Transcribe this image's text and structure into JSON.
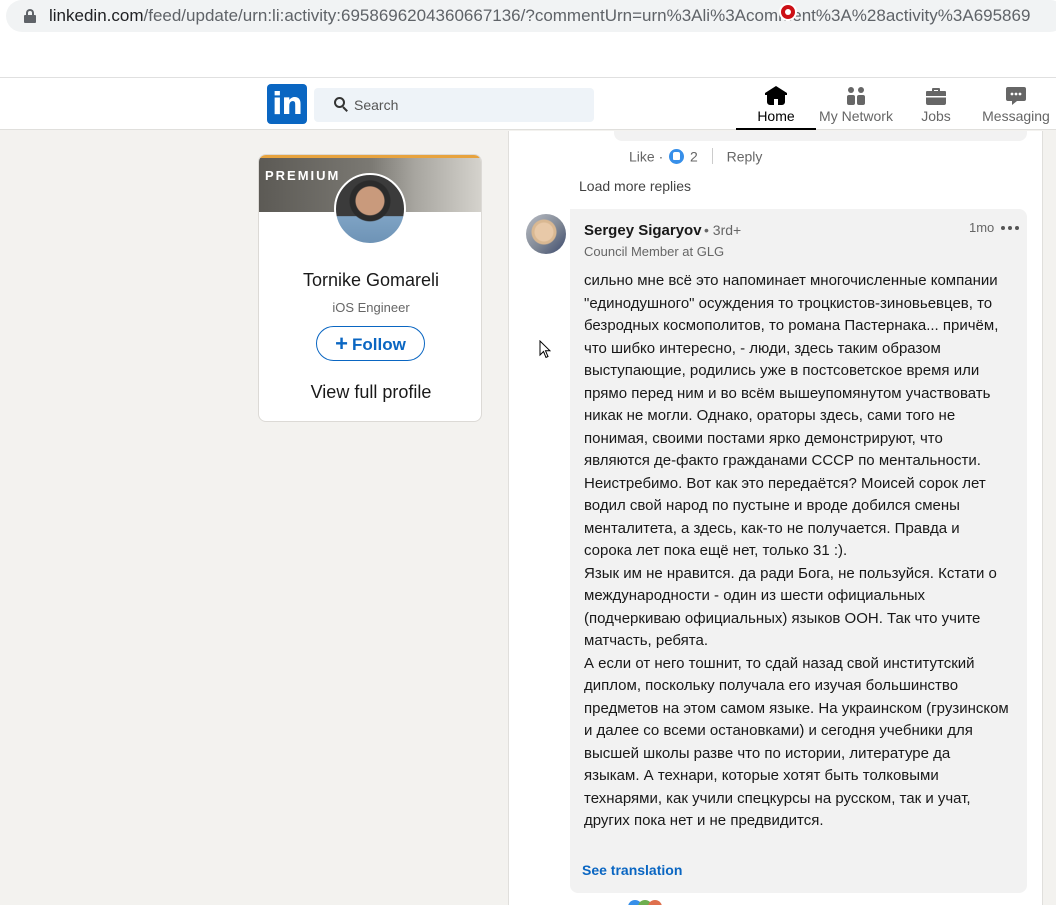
{
  "browser": {
    "url_host": "linkedin.com",
    "url_path": "/feed/update/urn:li:activity:6958696204360667136/?commentUrn=urn%3Ali%3Acomment%3A%28activity%3A695869"
  },
  "nav": {
    "logo": "in",
    "search_placeholder": "Search",
    "items": [
      {
        "label": "Home"
      },
      {
        "label": "My Network"
      },
      {
        "label": "Jobs"
      },
      {
        "label": "Messaging"
      }
    ]
  },
  "profile_card": {
    "premium_label": "PREMIUM",
    "name": "Tornike Gomareli",
    "title": "iOS Engineer",
    "follow_label": "Follow",
    "view_profile_label": "View full profile"
  },
  "previous_reply": {
    "like_label": "Like",
    "reaction_count": "2",
    "reply_label": "Reply"
  },
  "load_more_label": "Load more replies",
  "comment": {
    "author": "Sergey Sigaryov",
    "degree": "• 3rd+",
    "headline": "Council Member at GLG",
    "time": "1mo",
    "paragraphs": [
      "сильно мне всё это напоминает многочисленные компании \"единодушного\" осуждения то троцкистов-зиновьевцев, то безродных космополитов, то романа Пастернака... причём, что шибко интересно, - люди, здесь таким образом выступающие, родились уже в постсоветское время или прямо перед ним и во всём вышеупомянутом участвовать никак не могли. Однако, ораторы здесь, сами того не понимая, своими постами ярко демонстрируют, что являются де-факто гражданами СССР по ментальности. Неистребимо. Вот как это передаётся? Моисей сорок лет водил свой народ по пустыне и вроде добился смены менталитета, а здесь, как-то не получается. Правда и сорока лет пока ещё нет, только 31 :).",
      "Язык им не нравится. да ради Бога, не пользуйся. Кстати о международности - один из шести официальных (подчеркиваю официальных) языков ООН. Так что учите матчасть, ребята.",
      "А если от него тошнит, то сдай назад свой институтский диплом, поскольку получала его изучая большинство предметов на этом самом языке. На украинском (грузинском и далее со всеми остановками) и сегодня учебники для высшей школы разве что по истории, литературе да языкам. А технари, которые хотят быть толковыми технарями, как учили спецкурсы на русском, так и учат, других пока нет и не предвидится."
    ],
    "see_translation_label": "See translation"
  },
  "colors": {
    "brand": "#0a66c2",
    "notification": "#cc1016",
    "premium_accent": "#e7a33e"
  }
}
